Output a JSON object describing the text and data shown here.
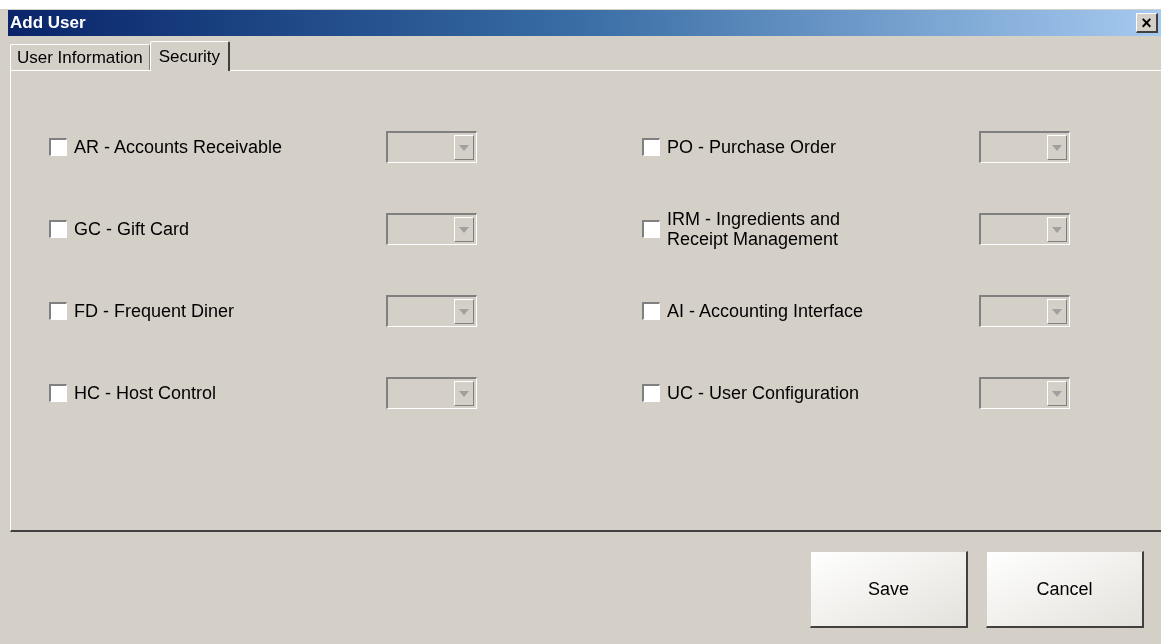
{
  "window": {
    "title": "Add User",
    "close": "×"
  },
  "tabs": [
    {
      "label": "User Information",
      "selected": false
    },
    {
      "label": "Security",
      "selected": true
    }
  ],
  "modules": [
    {
      "label": "AR - Accounts Receivable",
      "checked": false,
      "dropdown": {
        "disabled": true
      }
    },
    {
      "label": "PO - Purchase Order",
      "checked": false,
      "dropdown": {
        "disabled": true
      }
    },
    {
      "label": "GC - Gift Card",
      "checked": false,
      "dropdown": {
        "disabled": true
      }
    },
    {
      "label": "IRM - Ingredients and\nReceipt Management",
      "checked": false,
      "dropdown": {
        "disabled": true
      }
    },
    {
      "label": "FD - Frequent Diner",
      "checked": false,
      "dropdown": {
        "disabled": true
      }
    },
    {
      "label": "AI - Accounting Interface",
      "checked": false,
      "dropdown": {
        "disabled": true
      }
    },
    {
      "label": "HC - Host Control",
      "checked": false,
      "dropdown": {
        "disabled": true
      }
    },
    {
      "label": "UC - User Configuration",
      "checked": false,
      "dropdown": {
        "disabled": true
      }
    }
  ],
  "buttons": [
    "Save",
    "Cancel"
  ]
}
